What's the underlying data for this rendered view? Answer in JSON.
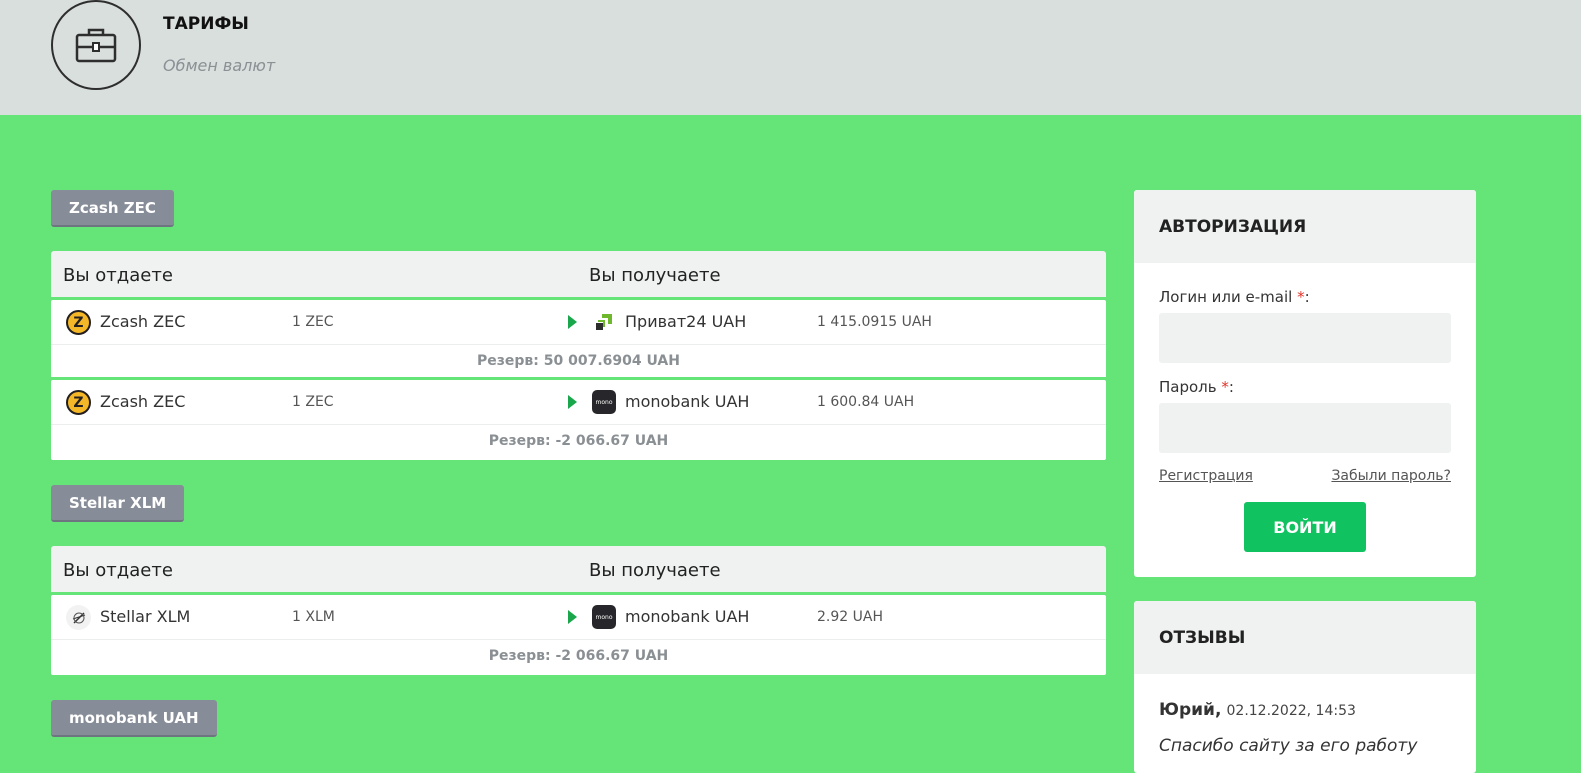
{
  "header": {
    "title": "ТАРИФЫ",
    "subtitle": "Обмен валют",
    "icon": "briefcase-icon"
  },
  "groups": [
    {
      "label": "Zcash ZEC",
      "col_give": "Вы отдаете",
      "col_get": "Вы получаете",
      "rates": [
        {
          "give_name": "Zcash ZEC",
          "give_amount": "1 ZEC",
          "get_name": "Приват24 UAH",
          "get_amount": "1 415.0915 UAH",
          "reserve": "Резерв: 50 007.6904 UAH",
          "give_icon": "zcash-icon",
          "get_icon": "privat24-icon"
        },
        {
          "give_name": "Zcash ZEC",
          "give_amount": "1 ZEC",
          "get_name": "monobank UAH",
          "get_amount": "1 600.84 UAH",
          "reserve": "Резерв: -2 066.67 UAH",
          "give_icon": "zcash-icon",
          "get_icon": "monobank-icon"
        }
      ]
    },
    {
      "label": "Stellar XLM",
      "col_give": "Вы отдаете",
      "col_get": "Вы получаете",
      "rates": [
        {
          "give_name": "Stellar XLM",
          "give_amount": "1 XLM",
          "get_name": "monobank UAH",
          "get_amount": "2.92 UAH",
          "reserve": "Резерв: -2 066.67 UAH",
          "give_icon": "stellar-icon",
          "get_icon": "monobank-icon"
        }
      ]
    },
    {
      "label": "monobank UAH"
    }
  ],
  "auth": {
    "title": "АВТОРИЗАЦИЯ",
    "login_label": "Логин или e-mail ",
    "password_label": "Пароль ",
    "required_mark": "*",
    "colon": ":",
    "register_link": "Регистрация",
    "forgot_link": "Забыли пароль?",
    "submit_label": "ВОЙТИ"
  },
  "reviews": {
    "title": "ОТЗЫВЫ",
    "items": [
      {
        "author": "Юрий,",
        "date": "02.12.2022, 14:53",
        "text": "Спасибо сайту за его работу"
      }
    ]
  },
  "mono_icon_text": "mono",
  "zec_icon_text": "Z",
  "colors": {
    "page_bg": "#65e577",
    "header_bg": "#d9dfdd",
    "group_button": "#878d98",
    "login_button": "#11c260",
    "arrow": "#1aa64b"
  }
}
